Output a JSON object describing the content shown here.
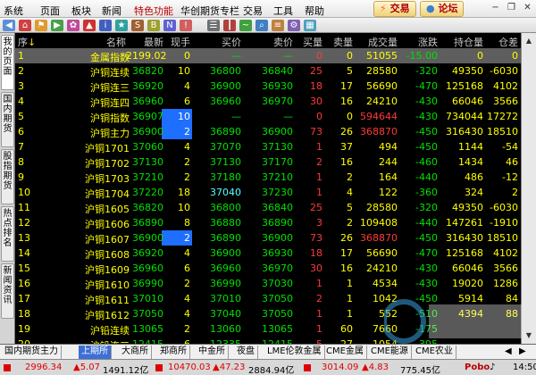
{
  "menu": {
    "items": [
      "系统",
      "页面",
      "板块",
      "新闻",
      "特色功能",
      "华创期货专栏",
      "交易",
      "工具",
      "帮助"
    ],
    "trade_button": "交易",
    "forum_button": "论坛"
  },
  "left_tabs": [
    "我的页面",
    "国内期货",
    "股指期货",
    "热点排名",
    "新闻资讯"
  ],
  "headers": [
    "序",
    "名称",
    "最新",
    "现手",
    "买价",
    "卖价",
    "买量",
    "卖量",
    "成交量",
    "涨跌",
    "持仓量",
    "仓差"
  ],
  "rows": [
    {
      "seq": "1",
      "name": "金属指数",
      "last": "2199.02",
      "vol": "0",
      "bid": "—",
      "ask": "—",
      "bq": "0",
      "aq": "0",
      "turnover": "51055",
      "chg": "-15.00",
      "oi": "0",
      "oid": "0"
    },
    {
      "seq": "2",
      "name": "沪铜连续",
      "last": "36820",
      "vol": "10",
      "bid": "36800",
      "ask": "36840",
      "bq": "25",
      "aq": "5",
      "turnover": "28580",
      "chg": "-320",
      "oi": "49350",
      "oid": "-6030"
    },
    {
      "seq": "3",
      "name": "沪铜连三",
      "last": "36920",
      "vol": "4",
      "bid": "36900",
      "ask": "36930",
      "bq": "18",
      "aq": "17",
      "turnover": "56690",
      "chg": "-470",
      "oi": "125168",
      "oid": "4102"
    },
    {
      "seq": "4",
      "name": "沪铜连四",
      "last": "36960",
      "vol": "6",
      "bid": "36960",
      "ask": "36970",
      "bq": "30",
      "aq": "16",
      "turnover": "24210",
      "chg": "-430",
      "oi": "66046",
      "oid": "3566"
    },
    {
      "seq": "5",
      "name": "沪铜指数",
      "last": "36907",
      "vol": "10",
      "bid": "—",
      "ask": "—",
      "bq": "0",
      "aq": "0",
      "turnover": "594644",
      "chg": "-430",
      "oi": "734044",
      "oid": "17272"
    },
    {
      "seq": "6",
      "name": "沪铜主力",
      "last": "36900",
      "vol": "2",
      "bid": "36890",
      "ask": "36900",
      "bq": "73",
      "aq": "26",
      "turnover": "368870",
      "chg": "-450",
      "oi": "316430",
      "oid": "18510"
    },
    {
      "seq": "7",
      "name": "沪铜1701",
      "last": "37060",
      "vol": "4",
      "bid": "37070",
      "ask": "37130",
      "bq": "1",
      "aq": "37",
      "turnover": "494",
      "chg": "-450",
      "oi": "1144",
      "oid": "-54"
    },
    {
      "seq": "8",
      "name": "沪铜1702",
      "last": "37130",
      "vol": "2",
      "bid": "37130",
      "ask": "37170",
      "bq": "2",
      "aq": "16",
      "turnover": "244",
      "chg": "-460",
      "oi": "1434",
      "oid": "46"
    },
    {
      "seq": "9",
      "name": "沪铜1703",
      "last": "37210",
      "vol": "2",
      "bid": "37180",
      "ask": "37210",
      "bq": "1",
      "aq": "2",
      "turnover": "164",
      "chg": "-440",
      "oi": "486",
      "oid": "-12"
    },
    {
      "seq": "10",
      "name": "沪铜1704",
      "last": "37220",
      "vol": "18",
      "bid": "37040",
      "ask": "37230",
      "bq": "1",
      "aq": "4",
      "turnover": "122",
      "chg": "-360",
      "oi": "324",
      "oid": "2"
    },
    {
      "seq": "11",
      "name": "沪铜1605",
      "last": "36820",
      "vol": "10",
      "bid": "36800",
      "ask": "36840",
      "bq": "25",
      "aq": "5",
      "turnover": "28580",
      "chg": "-320",
      "oi": "49350",
      "oid": "-6030"
    },
    {
      "seq": "12",
      "name": "沪铜1606",
      "last": "36890",
      "vol": "8",
      "bid": "36880",
      "ask": "36890",
      "bq": "3",
      "aq": "2",
      "turnover": "109408",
      "chg": "-440",
      "oi": "147261",
      "oid": "-1910"
    },
    {
      "seq": "13",
      "name": "沪铜1607",
      "last": "36900",
      "vol": "2",
      "bid": "36890",
      "ask": "36900",
      "bq": "73",
      "aq": "26",
      "turnover": "368870",
      "chg": "-450",
      "oi": "316430",
      "oid": "18510"
    },
    {
      "seq": "14",
      "name": "沪铜1608",
      "last": "36920",
      "vol": "4",
      "bid": "36900",
      "ask": "36930",
      "bq": "18",
      "aq": "17",
      "turnover": "56690",
      "chg": "-470",
      "oi": "125168",
      "oid": "4102"
    },
    {
      "seq": "15",
      "name": "沪铜1609",
      "last": "36960",
      "vol": "6",
      "bid": "36960",
      "ask": "36970",
      "bq": "30",
      "aq": "16",
      "turnover": "24210",
      "chg": "-430",
      "oi": "66046",
      "oid": "3566"
    },
    {
      "seq": "16",
      "name": "沪铜1610",
      "last": "36990",
      "vol": "2",
      "bid": "36990",
      "ask": "37030",
      "bq": "1",
      "aq": "1",
      "turnover": "4534",
      "chg": "-430",
      "oi": "19020",
      "oid": "1286"
    },
    {
      "seq": "17",
      "name": "沪铜1611",
      "last": "37010",
      "vol": "4",
      "bid": "37010",
      "ask": "37050",
      "bq": "2",
      "aq": "1",
      "turnover": "1042",
      "chg": "-450",
      "oi": "5914",
      "oid": "84"
    },
    {
      "seq": "18",
      "name": "沪铜1612",
      "last": "37050",
      "vol": "4",
      "bid": "37040",
      "ask": "37050",
      "bq": "1",
      "aq": "1",
      "turnover": "552",
      "chg": "-510",
      "oi": "4394",
      "oid": "88"
    },
    {
      "seq": "19",
      "name": "沪铅连续",
      "last": "13065",
      "vol": "2",
      "bid": "13060",
      "ask": "13065",
      "bq": "1",
      "aq": "60",
      "turnover": "7660",
      "chg": "-175",
      "oi": "",
      "oid": ""
    },
    {
      "seq": "20",
      "name": "沪铅连三",
      "last": "12415",
      "vol": "6",
      "bid": "12335",
      "ask": "12415",
      "bq": "5",
      "aq": "27",
      "turnover": "1054",
      "chg": "-395",
      "oi": "",
      "oid": ""
    },
    {
      "seq": "21",
      "name": "沪铅连四",
      "last": "12335",
      "vol": "18",
      "bid": "12325",
      "ask": "12360",
      "bq": "12",
      "aq": "3",
      "turnover": "1510",
      "chg": "-280",
      "oi": "",
      "oid": ""
    }
  ],
  "bottom_tabs": [
    "国内期货主力",
    "上期所",
    "大商所",
    "郑商所",
    "中金所",
    "夜盘",
    "LME伦敦金属",
    "CME金属",
    "CME能源",
    "CME农业"
  ],
  "status": {
    "idx1_val": "2996.34",
    "idx1_chg": "5.07",
    "idx1_amt": "1491.12亿",
    "idx2_val": "10470.03",
    "idx2_chg": "47.23",
    "idx2_amt": "2884.94亿",
    "idx3_val": "3014.09",
    "idx3_chg": "4.83",
    "idx3_amt": "775.45亿",
    "brand": "Pobo",
    "time": "14:50"
  }
}
